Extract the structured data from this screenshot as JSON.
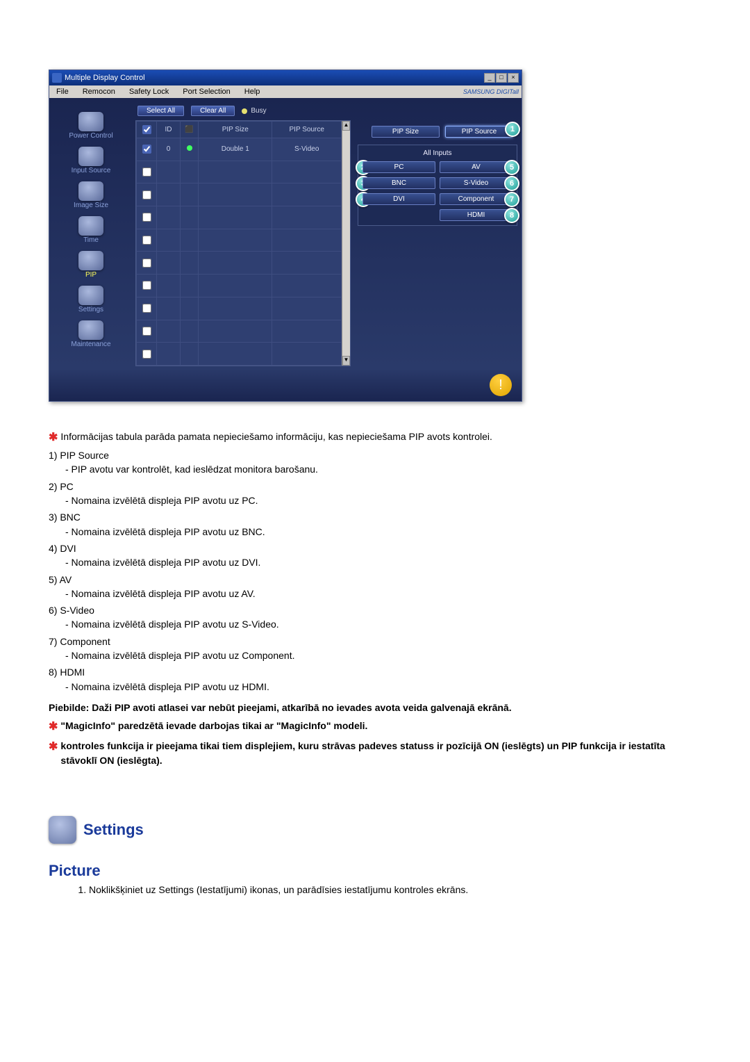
{
  "window": {
    "title": "Multiple Display Control",
    "brand": "SAMSUNG DIGITall"
  },
  "menubar": {
    "file": "File",
    "remocon": "Remocon",
    "safety": "Safety Lock",
    "port": "Port Selection",
    "help": "Help"
  },
  "sidebar": {
    "items": [
      {
        "label": "Power Control"
      },
      {
        "label": "Input Source"
      },
      {
        "label": "Image Size"
      },
      {
        "label": "Time"
      },
      {
        "label": "PIP",
        "active": true
      },
      {
        "label": "Settings"
      },
      {
        "label": "Maintenance"
      }
    ]
  },
  "toolbar": {
    "select_all": "Select All",
    "clear_all": "Clear All",
    "busy": "Busy"
  },
  "grid": {
    "headers": {
      "id": "ID",
      "pipsize": "PIP Size",
      "pipsource": "PIP Source"
    },
    "rows": [
      {
        "checked": true,
        "id": "0",
        "status": true,
        "pipsize": "Double 1",
        "pipsource": "S-Video"
      },
      {
        "checked": false
      },
      {
        "checked": false
      },
      {
        "checked": false
      },
      {
        "checked": false
      },
      {
        "checked": false
      },
      {
        "checked": false
      },
      {
        "checked": false
      },
      {
        "checked": false
      },
      {
        "checked": false
      }
    ]
  },
  "right_panel": {
    "pipsize": "PIP Size",
    "pipsource": "PIP Source",
    "all_inputs": "All Inputs",
    "pc": "PC",
    "av": "AV",
    "bnc": "BNC",
    "svideo": "S-Video",
    "dvi": "DVI",
    "component": "Component",
    "hdmi": "HDMI"
  },
  "callouts": {
    "c1": "1",
    "c2": "2",
    "c3": "3",
    "c4": "4",
    "c5": "5",
    "c6": "6",
    "c7": "7",
    "c8": "8"
  },
  "text": {
    "intro": "Informācijas tabula parāda pamata nepieciešamo informāciju, kas nepieciešama PIP avots kontrolei.",
    "items": [
      {
        "num": "1)",
        "name": "PIP Source",
        "desc": "- PIP avotu var kontrolēt, kad ieslēdzat monitora barošanu."
      },
      {
        "num": "2)",
        "name": "PC",
        "desc": "- Nomaina izvēlētā displeja PIP avotu uz PC."
      },
      {
        "num": "3)",
        "name": "BNC",
        "desc": "- Nomaina izvēlētā displeja PIP avotu uz BNC."
      },
      {
        "num": "4)",
        "name": "DVI",
        "desc": "- Nomaina izvēlētā displeja PIP avotu uz DVI."
      },
      {
        "num": "5)",
        "name": "AV",
        "desc": "- Nomaina izvēlētā displeja PIP avotu uz AV."
      },
      {
        "num": "6)",
        "name": "S-Video",
        "desc": "- Nomaina izvēlētā displeja PIP avotu uz S-Video."
      },
      {
        "num": "7)",
        "name": "Component",
        "desc": "- Nomaina izvēlētā displeja PIP avotu uz Component."
      },
      {
        "num": "8)",
        "name": "HDMI",
        "desc": "- Nomaina izvēlētā displeja PIP avotu uz HDMI."
      }
    ],
    "piebilde": "Piebilde: Daži PIP avoti atlasei var nebūt pieejami, atkarībā no ievades avota veida galvenajā ekrānā.",
    "star1": "\"MagicInfo\" paredzētā ievade darbojas tikai ar \"MagicInfo\" modeli.",
    "star2": "kontroles funkcija ir pieejama tikai tiem displejiem, kuru strāvas padeves statuss ir pozīcijā ON (ieslēgts) un PIP funkcija ir iestatīta stāvoklī ON (ieslēgta)."
  },
  "settings": {
    "heading": "Settings",
    "picture": "Picture",
    "step1": "Noklikšķiniet uz Settings (Iestatījumi) ikonas, un parādīsies iestatījumu kontroles ekrāns."
  }
}
